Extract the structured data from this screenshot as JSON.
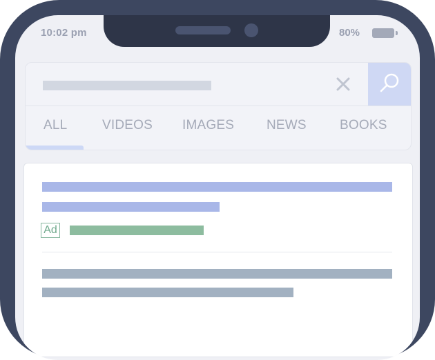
{
  "status_bar": {
    "time": "10:02 pm",
    "battery": "80%"
  },
  "search": {
    "clear_icon": "close-icon",
    "search_icon": "search-icon"
  },
  "tabs": [
    {
      "label": "ALL",
      "active": true
    },
    {
      "label": "VIDEOS",
      "active": false
    },
    {
      "label": "IMAGES",
      "active": false
    },
    {
      "label": "NEWS",
      "active": false
    },
    {
      "label": "BOOKS",
      "active": false
    }
  ],
  "results": {
    "ad_badge": "Ad"
  },
  "colors": {
    "frame": "#3d4760",
    "notch": "#2e3548",
    "accent": "#cfd8f4",
    "ad_title": "#a9b7e8",
    "ad_url": "#8dbc9f",
    "organic": "#a2b1c1"
  }
}
